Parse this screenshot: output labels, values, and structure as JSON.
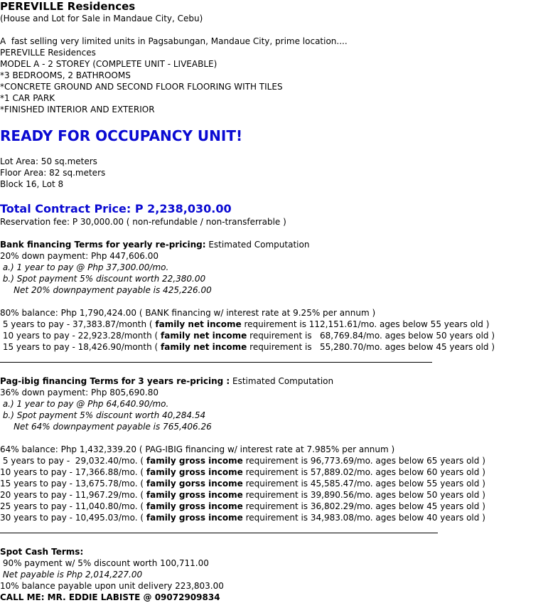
{
  "header": {
    "title": "PEREVILLE Residences",
    "subtitle": "(House and Lot for Sale in Mandaue City, Cebu)"
  },
  "intro": {
    "line1": "A  fast selling very limited units in Pagsabungan, Mandaue City, prime location....",
    "line2": "PEREVILLE Residences",
    "line3": "MODEL A - 2 STOREY (COMPLETE UNIT - LIVEABLE)",
    "line4": "*3 BEDROOMS, 2 BATHROOMS",
    "line5": "*CONCRETE GROUND AND SECOND FLOOR FLOORING WITH TILES",
    "line6": "*1 CAR PARK",
    "line7": "*FINISHED INTERIOR AND EXTERIOR"
  },
  "ready": "READY FOR OCCUPANCY UNIT!",
  "lot": {
    "area": "Lot Area: 50 sq.meters",
    "floor": "Floor Area: 82 sq.meters",
    "block": "Block 16, Lot 8"
  },
  "price": {
    "total": "Total Contract Price: P 2,238,030.00",
    "reservation": "Reservation fee: P 30,000.00 ( non-refundable / non-transferrable )"
  },
  "bank": {
    "heading_bold": "Bank financing Terms for yearly re-pricing:",
    "heading_rest": " Estimated Computation",
    "down": "20% down payment: Php 447,606.00",
    "opt_a": " a.) 1 year to pay @ Php 37,300.00/mo.",
    "opt_b": " b.) Spot payment 5% discount worth 22,380.00",
    "net": "     Net 20% downpayment payable is 425,226.00",
    "balance": "80% balance: Php 1,790,424.00 ( BANK financing w/ interest rate at 9.25% per annum )",
    "rows": [
      {
        "pre": " 5 years to pay - 37,383.87/month ( ",
        "bold": "family net income",
        "post": " requirement is 112,151.61/mo. ages below 55 years old )"
      },
      {
        "pre": " 10 years to pay - 22,923.28/month ( ",
        "bold": "family net income",
        "post": " requirement is   68,769.84/mo. ages below 50 years old )"
      },
      {
        "pre": " 15 years to pay - 18,426.90/month ( ",
        "bold": "family net income",
        "post": " requirement is   55,280.70/mo. ages below 45 years old )"
      }
    ]
  },
  "pagibig": {
    "heading_bold": "Pag-ibig financing Terms for 3 years re-pricing :",
    "heading_rest": " Estimated Computation",
    "down": "36% down payment: Php 805,690.80",
    "opt_a": " a.) 1 year to pay @ Php 64,640.90/mo.",
    "opt_b": " b.) Spot payment 5% discount worth 40,284.54",
    "net": "     Net 64% downpayment payable is 765,406.26",
    "balance": "64% balance: Php 1,432,339.20 ( PAG-IBIG financing w/ interest rate at 7.985% per annum )",
    "rows": [
      {
        "pre": " 5 years to pay -  29,032.40/mo. ( ",
        "bold": "family gross income",
        "post": " requirement is 96,773.69/mo. ages below 65 years old )"
      },
      {
        "pre": "10 years to pay - 17,366.88/mo. ( ",
        "bold": "family gross income",
        "post": " requirement is 57,889.02/mo. ages below 60 years old )"
      },
      {
        "pre": "15 years to pay - 13,675.78/mo. ( ",
        "bold": "family gorss income",
        "post": " requirement is 45,585.47/mo. ages below 55 years old )"
      },
      {
        "pre": "20 years to pay - 11,967.29/mo. ( ",
        "bold": "family gross income",
        "post": " requirement is 39,890.56/mo. ages below 50 years old )"
      },
      {
        "pre": "25 years to pay - 11,040.80/mo. ( ",
        "bold": "family gross income",
        "post": " requirement is 36,802.29/mo. ages below 45 years old )"
      },
      {
        "pre": "30 years to pay - 10,495.03/mo. ( ",
        "bold": "family gross income",
        "post": " requirement is 34,983.08/mo. ages below 40 years old )"
      }
    ]
  },
  "cash": {
    "heading": "Spot Cash Terms:",
    "line1": " 90% payment w/ 5% discount worth 100,711.00",
    "line2": " Net payable is Php 2,014,227.00",
    "line3": "10% balance payable upon unit delivery 223,803.00",
    "contact": "CALL ME: MR. EDDIE LABISTE @ 09072909834"
  }
}
